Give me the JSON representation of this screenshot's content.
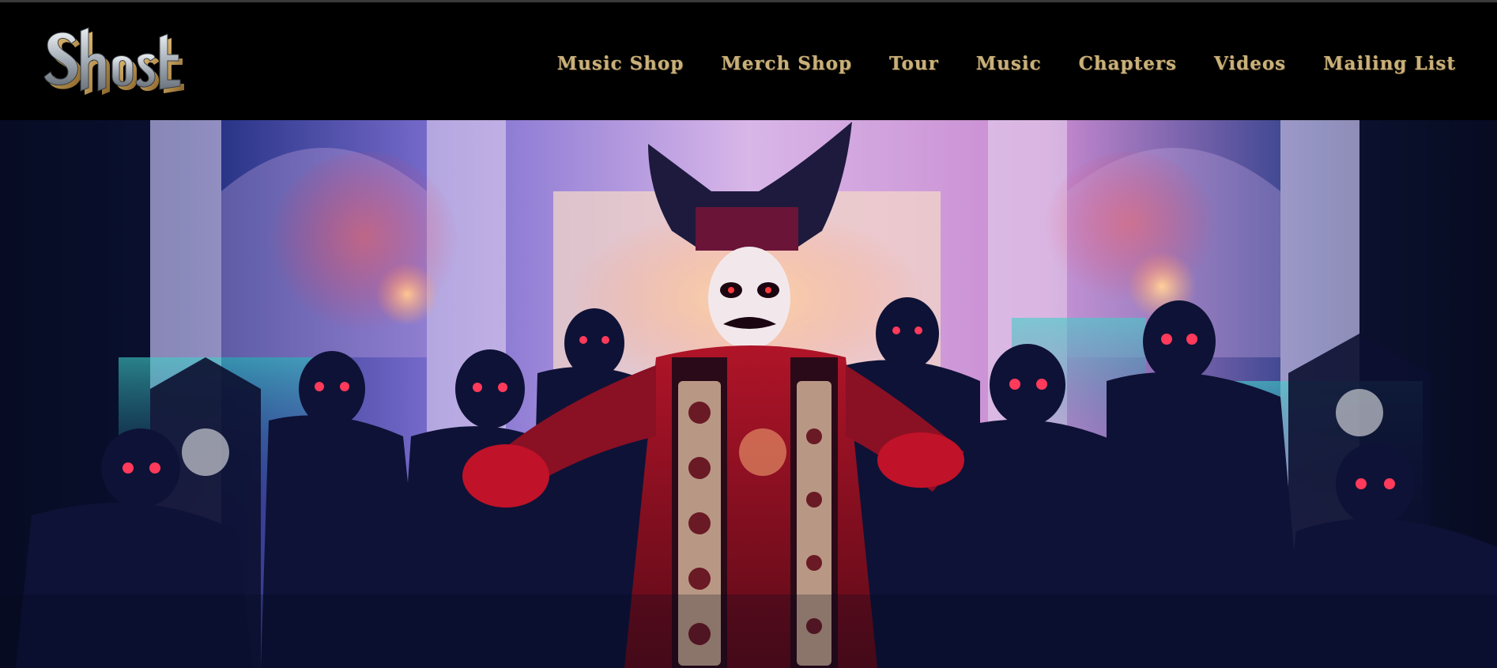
{
  "site": {
    "logo_text": "Ghost",
    "logo_icon": "ghost-logo"
  },
  "nav": {
    "items": [
      {
        "label": "Music Shop"
      },
      {
        "label": "Merch Shop"
      },
      {
        "label": "Tour"
      },
      {
        "label": "Music"
      },
      {
        "label": "Chapters"
      },
      {
        "label": "Videos"
      },
      {
        "label": "Mailing List"
      }
    ]
  },
  "hero": {
    "image": "band-promo-photo"
  },
  "colors": {
    "header_bg": "#000000",
    "nav_text": "#c9b07a",
    "logo_metal": "#b8c0c8",
    "logo_gold": "#c8a050"
  }
}
